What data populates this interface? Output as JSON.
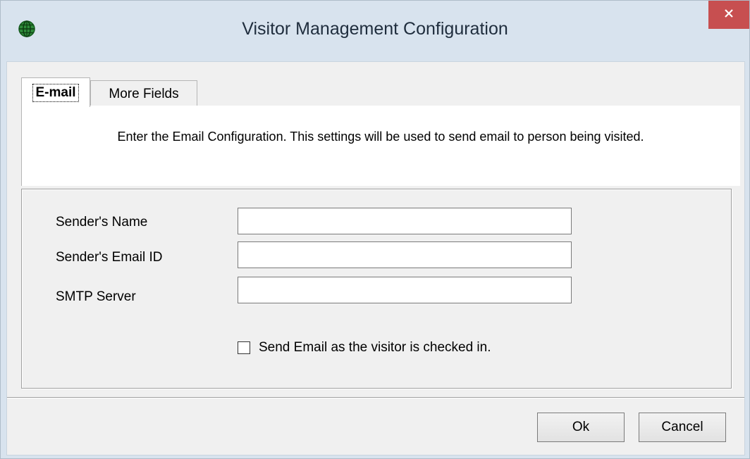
{
  "window": {
    "title": "Visitor Management Configuration",
    "close_glyph": "✕",
    "app_icon": "globe-icon",
    "close_color": "#c74f50"
  },
  "tabs": [
    {
      "label": "E-mail",
      "selected": true
    },
    {
      "label": "More Fields",
      "selected": false
    }
  ],
  "email_tab": {
    "description": "Enter the Email Configuration. This settings will be used to send email to person being visited.",
    "fields": [
      {
        "label": "Sender's Name",
        "value": ""
      },
      {
        "label": "Sender's Email ID",
        "value": ""
      },
      {
        "label": "SMTP Server",
        "value": ""
      }
    ],
    "checkbox": {
      "label": "Send Email as the visitor is checked in.",
      "checked": false
    }
  },
  "buttons": {
    "ok": "Ok",
    "cancel": "Cancel"
  }
}
